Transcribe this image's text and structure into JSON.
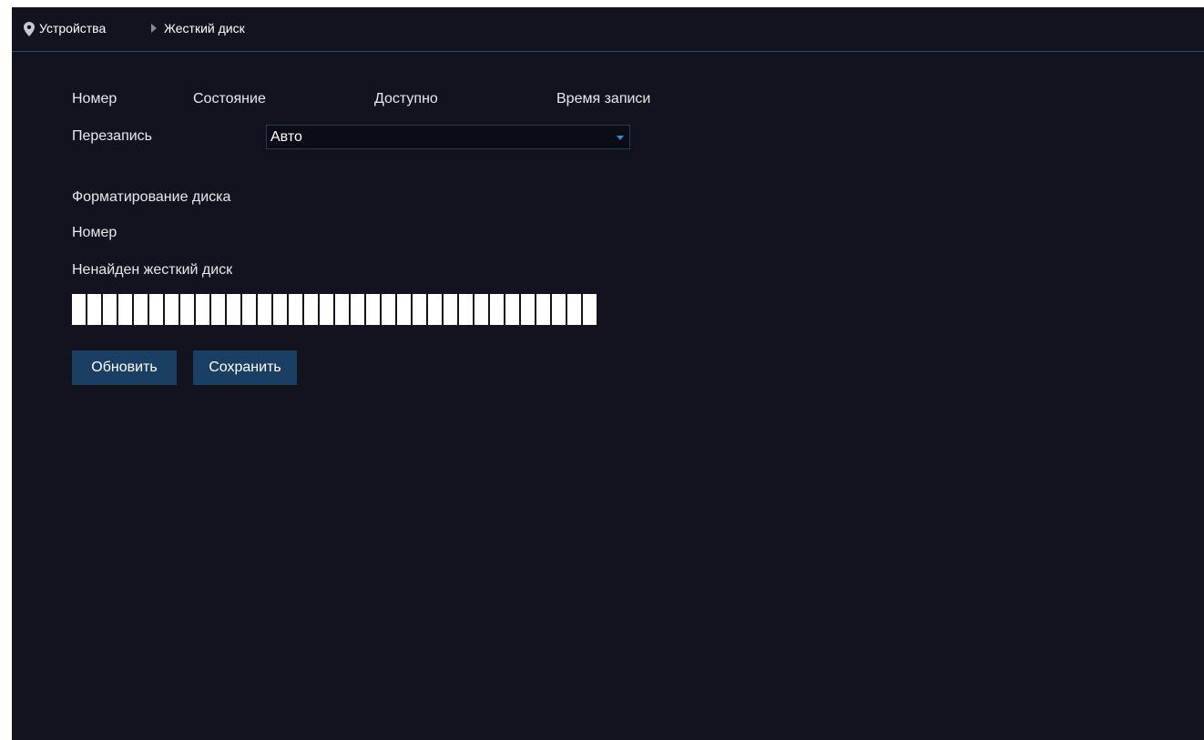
{
  "breadcrumb": {
    "items": [
      "Устройства",
      "Жесткий диск"
    ],
    "icon": "map-pin-icon",
    "separator_icon": "triangle-right-icon"
  },
  "disk_table": {
    "headers": [
      "Номер",
      "Состояние",
      "Доступно",
      "Время записи"
    ]
  },
  "overwrite": {
    "label": "Перезапись",
    "value": "Авто",
    "icon": "caret-down-icon"
  },
  "format": {
    "title": "Форматирование диска",
    "number_label": "Номер",
    "status_text": "Ненайден жесткий диск",
    "progress_segments": 34
  },
  "buttons": {
    "refresh": "Обновить",
    "save": "Сохранить"
  },
  "colors": {
    "background": "#13131f",
    "accent": "#1a3f63",
    "divider": "#1f4d78",
    "dropdown_arrow": "#2a8fd6"
  }
}
